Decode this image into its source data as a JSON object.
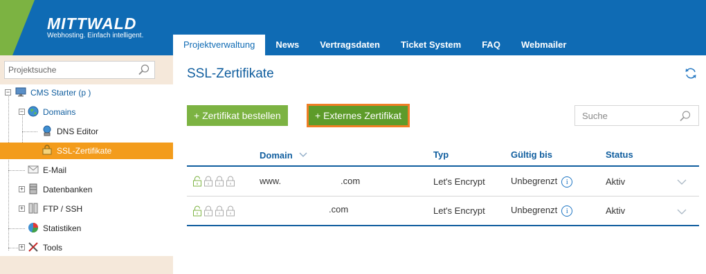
{
  "brand": {
    "name": "MITTWALD",
    "tagline": "Webhosting. Einfach intelligent.",
    "colors": {
      "header": "#0f6bb4",
      "green": "#7cb342",
      "orange": "#f39c1c"
    }
  },
  "nav": {
    "tabs": [
      {
        "label": "Projektverwaltung",
        "active": true
      },
      {
        "label": "News"
      },
      {
        "label": "Vertragsdaten"
      },
      {
        "label": "Ticket System"
      },
      {
        "label": "FAQ"
      },
      {
        "label": "Webmailer"
      }
    ]
  },
  "sidebar": {
    "search_placeholder": "Projektsuche",
    "tree": [
      {
        "label": "CMS Starter (p            )",
        "icon": "monitor-icon"
      },
      {
        "label": "Domains",
        "icon": "globe-icon"
      },
      {
        "label": "DNS Editor",
        "icon": "dns-icon"
      },
      {
        "label": "SSL-Zertifikate",
        "icon": "certificate-icon",
        "selected": true
      },
      {
        "label": "E-Mail",
        "icon": "mail-icon"
      },
      {
        "label": "Datenbanken",
        "icon": "database-icon"
      },
      {
        "label": "FTP / SSH",
        "icon": "ftp-icon"
      },
      {
        "label": "Statistiken",
        "icon": "pie-chart-icon"
      },
      {
        "label": "Tools",
        "icon": "tools-icon"
      }
    ]
  },
  "main": {
    "title": "SSL-Zertifikate",
    "order_button": "+ Zertifikat bestellen",
    "external_button": "+ Externes Zertifikat",
    "search_placeholder": "Suche",
    "table": {
      "headers": {
        "domain": "Domain",
        "type": "Typ",
        "valid": "Gültig bis",
        "status": "Status"
      },
      "rows": [
        {
          "domain_prefix": "www.",
          "domain_suffix": ".com",
          "type": "Let's Encrypt",
          "valid": "Unbegrenzt",
          "status": "Aktiv"
        },
        {
          "domain_prefix": "",
          "domain_suffix": ".com",
          "type": "Let's Encrypt",
          "valid": "Unbegrenzt",
          "status": "Aktiv"
        }
      ],
      "info_glyph": "i"
    }
  }
}
